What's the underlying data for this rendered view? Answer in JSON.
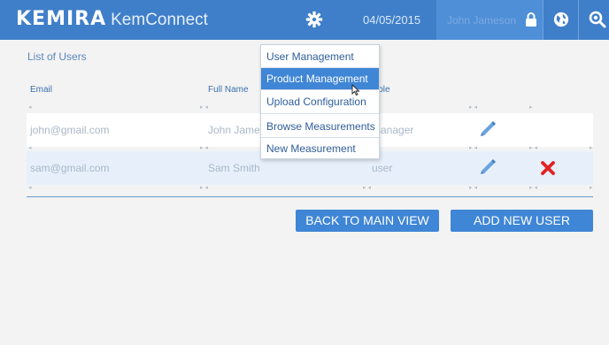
{
  "header": {
    "logo": "KEMIRA",
    "app_name": "KemConnect",
    "date": "04/05/2015",
    "user": "John Jameson"
  },
  "list": {
    "title": "List of Users",
    "columns": [
      "Email",
      "Full Name",
      "Role"
    ],
    "rows": [
      {
        "email": "john@gmail.com",
        "full_name": "John Jameson",
        "role": "manager",
        "deletable": false
      },
      {
        "email": "sam@gmail.com",
        "full_name": "Sam Smith",
        "role": "user",
        "deletable": true
      }
    ]
  },
  "menu": {
    "items": [
      {
        "label": "User Management",
        "active": false
      },
      {
        "label": "Product Management",
        "active": true
      },
      {
        "label": "Upload Configuration",
        "active": false
      },
      {
        "label": "Browse Measurements",
        "active": false
      },
      {
        "label": "New Measurement",
        "active": false
      }
    ]
  },
  "actions": {
    "back_label": "BACK TO MAIN VIEW",
    "add_label": "ADD NEW USER"
  },
  "colors": {
    "accent": "#3f86d6",
    "header": "#3f7fc9",
    "delete": "#e02424"
  },
  "icons": [
    "gear-icon",
    "lock-icon",
    "globe-icon",
    "search-icon",
    "edit-icon",
    "delete-icon",
    "cursor-icon"
  ]
}
